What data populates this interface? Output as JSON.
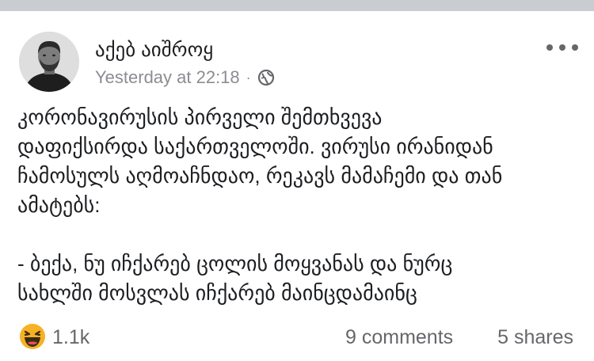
{
  "post": {
    "author": "აქებ აიშროყ",
    "timestamp": "Yesterday at 22:18",
    "separator": "·",
    "privacy_icon": "globe-icon",
    "more_icon": "more-options-icon",
    "text": "კორონავირუსის პირველი შემთხვევა\nდაფიქსირდა საქართველოში. ვირუსი ირანიდან\nჩამოსულს აღმოაჩნდაო, რეკავს მამაჩემი და თან\nამატებს:\n\n- ბექა, ნუ იჩქარებ ცოლის მოყვანას და ნურც\nსახლში მოსვლას იჩქარებ მაინცდამაინც"
  },
  "footer": {
    "reaction_icon": "haha-reaction-icon",
    "reaction_count": "1.1k",
    "comments": "9 comments",
    "shares": "5 shares"
  },
  "colors": {
    "topbar": "#c9ccd1",
    "meta_text": "#8a8d91",
    "haha_yellow": "#f7b125"
  }
}
